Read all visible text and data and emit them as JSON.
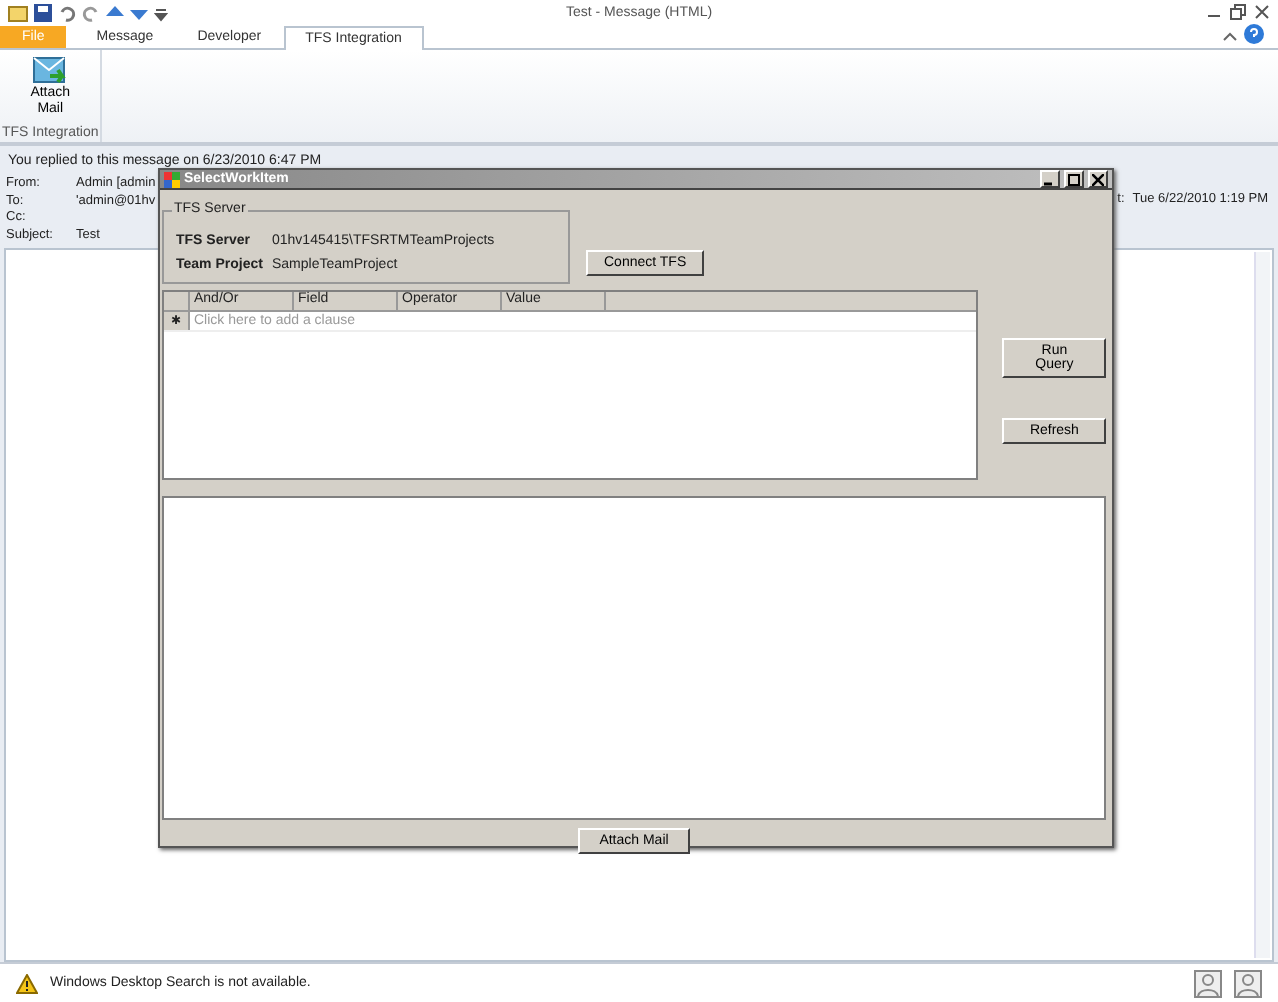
{
  "window": {
    "title": "Test - Message (HTML)"
  },
  "ribbon_tabs": [
    {
      "label": "File",
      "kind": "file",
      "selected": false
    },
    {
      "label": "Message",
      "kind": "tab",
      "selected": false
    },
    {
      "label": "Developer",
      "kind": "tab",
      "selected": false
    },
    {
      "label": "TFS Integration",
      "kind": "tab",
      "selected": true
    }
  ],
  "ribbon": {
    "button": "Attach\nMail",
    "group": "TFS Integration"
  },
  "info_bar": "You replied to this message on 6/23/2010 6:47 PM",
  "header": [
    {
      "label": "From:",
      "value": "Admin [admin"
    },
    {
      "label": "To:",
      "value": "'admin@01hv"
    },
    {
      "label": "Cc:"
    },
    {
      "label": "Subject:",
      "value": "Test"
    }
  ],
  "sent": {
    "label": "t:",
    "value": "Tue 6/22/2010 1:19 PM"
  },
  "dialog": {
    "title": "SelectWorkItem",
    "group_title": "TFS Server",
    "fields": [
      {
        "label": "TFS Server",
        "value": "01hv145415\\TFSRTMTeamProjects"
      },
      {
        "label": "Team Project",
        "value": "SampleTeamProject"
      }
    ],
    "connect_button": "Connect TFS",
    "columns": [
      "And/Or",
      "Field",
      "Operator",
      "Value"
    ],
    "new_row_marker": "✱",
    "new_row_text": "Click here to add a clause",
    "run_button": "Run Query",
    "refresh_button": "Refresh",
    "attach_button": "Attach Mail"
  },
  "status_bar": "Windows Desktop Search is not available."
}
